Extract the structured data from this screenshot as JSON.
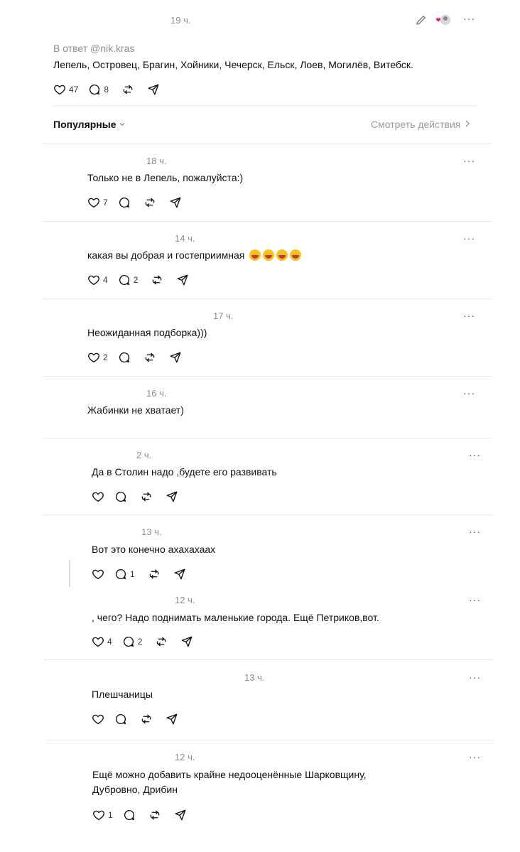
{
  "top_post": {
    "time": "19 ч.",
    "reply_to": "В ответ @nik.kras",
    "text": "Лепель, Островец, Брагин, Хойники, Чечерск, Ельск, Лоев, Могилёв, Витебск.",
    "likes": "47",
    "replies": "8"
  },
  "sort": {
    "label": "Популярные",
    "view_activity": "Смотреть действия"
  },
  "comments": [
    {
      "time": "18 ч.",
      "text": "Только не в Лепель, пожалуйста:)",
      "likes": "7",
      "replies": ""
    },
    {
      "time": "14 ч.",
      "text": "какая вы добрая и гостеприимная",
      "likes": "4",
      "replies": "2"
    },
    {
      "time": "17 ч.",
      "text": "Неожиданная подборка)))",
      "likes": "2",
      "replies": ""
    },
    {
      "time": "16 ч.",
      "text": "Жабинки не хватает)",
      "likes": "",
      "replies": ""
    },
    {
      "time": "2 ч.",
      "text": "Да в Столин надо ,будете его развивать",
      "likes": "",
      "replies": ""
    },
    {
      "time": "13 ч.",
      "text": "Вот это конечно ахахахаах",
      "likes": "",
      "replies": "1"
    },
    {
      "time": "12 ч.",
      "text": ", чего? Надо поднимать маленькие города. Ещё Петриков,вот.",
      "likes": "4",
      "replies": "2"
    },
    {
      "time": "13 ч.",
      "text": "Плешчаницы",
      "likes": "",
      "replies": ""
    },
    {
      "time": "12 ч.",
      "text_line1": "Ещё можно добавить крайне недооценённые Шарковщину,",
      "text_line2": "Дубровно, Дрибин",
      "likes": "1",
      "replies": ""
    }
  ],
  "icons": {
    "more": "more-icon",
    "like": "heart-icon",
    "reply": "comment-icon",
    "repost": "repost-icon",
    "share": "share-icon",
    "edit": "pencil-icon"
  }
}
